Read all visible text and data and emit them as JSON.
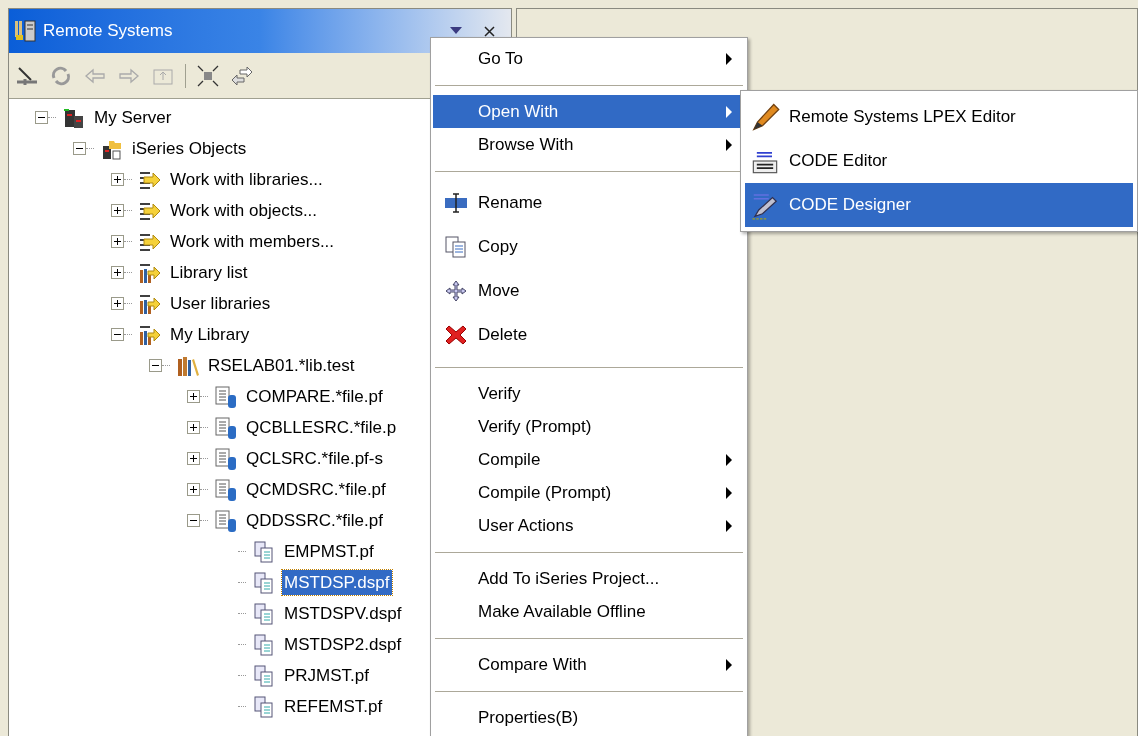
{
  "view": {
    "title": "Remote Systems"
  },
  "tree": [
    {
      "label": "My Server",
      "kind": "server",
      "expanded": true,
      "selected": false,
      "children": [
        {
          "label": "iSeries Objects",
          "kind": "objects",
          "expanded": true,
          "selected": false,
          "children": [
            {
              "label": "Work with libraries...",
              "kind": "filter",
              "expanded": false,
              "selected": false
            },
            {
              "label": "Work with objects...",
              "kind": "filter",
              "expanded": false,
              "selected": false
            },
            {
              "label": "Work with members...",
              "kind": "filter",
              "expanded": false,
              "selected": false
            },
            {
              "label": "Library list",
              "kind": "library-filter",
              "expanded": false,
              "selected": false
            },
            {
              "label": "User libraries",
              "kind": "library-filter",
              "expanded": false,
              "selected": false
            },
            {
              "label": "My Library",
              "kind": "library-filter",
              "expanded": true,
              "selected": false,
              "children": [
                {
                  "label": "RSELAB01.*lib.test",
                  "kind": "library",
                  "expanded": true,
                  "selected": false,
                  "children": [
                    {
                      "label": "COMPARE.*file.pf",
                      "kind": "file",
                      "expanded": false,
                      "selected": false
                    },
                    {
                      "label": "QCBLLESRC.*file.p",
                      "kind": "file",
                      "expanded": false,
                      "selected": false
                    },
                    {
                      "label": "QCLSRC.*file.pf-s",
                      "kind": "file",
                      "expanded": false,
                      "selected": false
                    },
                    {
                      "label": "QCMDSRC.*file.pf",
                      "kind": "file",
                      "expanded": false,
                      "selected": false
                    },
                    {
                      "label": "QDDSSRC.*file.pf",
                      "kind": "file",
                      "expanded": true,
                      "selected": false,
                      "children": [
                        {
                          "label": "EMPMST.pf",
                          "kind": "member",
                          "selected": false
                        },
                        {
                          "label": "MSTDSP.dspf",
                          "kind": "member",
                          "selected": true
                        },
                        {
                          "label": "MSTDSPV.dspf",
                          "kind": "member",
                          "selected": false
                        },
                        {
                          "label": "MSTDSP2.dspf",
                          "kind": "member",
                          "selected": false
                        },
                        {
                          "label": "PRJMST.pf",
                          "kind": "member",
                          "selected": false
                        },
                        {
                          "label": "REFEMST.pf",
                          "kind": "member",
                          "selected": false
                        }
                      ]
                    }
                  ]
                }
              ]
            }
          ]
        }
      ]
    }
  ],
  "context_menu": {
    "items": [
      {
        "kind": "item",
        "label": "Go To",
        "submenu": true,
        "selected": false
      },
      {
        "kind": "separator"
      },
      {
        "kind": "item",
        "label": "Open With",
        "submenu": true,
        "selected": true
      },
      {
        "kind": "item",
        "label": "Browse With",
        "submenu": true,
        "selected": false
      },
      {
        "kind": "separator"
      },
      {
        "kind": "rename",
        "label": "Rename",
        "submenu": false,
        "selected": false
      },
      {
        "kind": "copy",
        "label": "Copy",
        "submenu": false,
        "selected": false
      },
      {
        "kind": "move",
        "label": "Move",
        "submenu": false,
        "selected": false
      },
      {
        "kind": "delete",
        "label": "Delete",
        "submenu": false,
        "selected": false
      },
      {
        "kind": "separator"
      },
      {
        "kind": "item",
        "label": "Verify",
        "submenu": false,
        "selected": false
      },
      {
        "kind": "item",
        "label": "Verify (Prompt)",
        "submenu": false,
        "selected": false
      },
      {
        "kind": "item",
        "label": "Compile",
        "submenu": true,
        "selected": false
      },
      {
        "kind": "item",
        "label": "Compile (Prompt)",
        "submenu": true,
        "selected": false
      },
      {
        "kind": "item",
        "label": "User Actions",
        "submenu": true,
        "selected": false
      },
      {
        "kind": "separator"
      },
      {
        "kind": "item",
        "label": "Add To iSeries Project...",
        "submenu": false,
        "selected": false
      },
      {
        "kind": "item",
        "label": "Make Available Offline",
        "submenu": false,
        "selected": false
      },
      {
        "kind": "separator"
      },
      {
        "kind": "item",
        "label": "Compare With",
        "submenu": true,
        "selected": false
      },
      {
        "kind": "separator"
      },
      {
        "kind": "item",
        "label": "Properties(B)",
        "submenu": false,
        "selected": false
      }
    ]
  },
  "open_with_submenu": {
    "items": [
      {
        "kind": "pencil",
        "label": "Remote Systems LPEX Editor",
        "selected": false
      },
      {
        "kind": "code",
        "label": "CODE Editor",
        "selected": false
      },
      {
        "kind": "designer",
        "label": "CODE Designer",
        "selected": true
      }
    ]
  }
}
